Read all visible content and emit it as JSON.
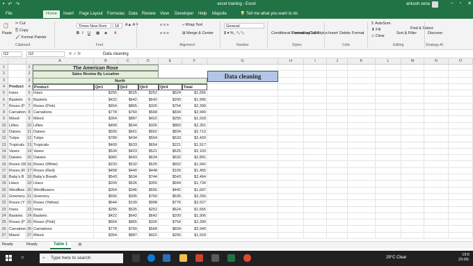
{
  "app": {
    "title": "excel training  -  Excel",
    "user": "ankush sena",
    "tabs": [
      "File",
      "Home",
      "Insert",
      "Page Layout",
      "Formulas",
      "Data",
      "Review",
      "View",
      "Developer",
      "Help",
      "Mapcite"
    ],
    "active_tab": "Home",
    "tell_me": "Tell me what you want to do",
    "accent": "#217346"
  },
  "ribbon": {
    "clipboard": {
      "paste": "Paste",
      "cut": "Cut",
      "copy": "Copy",
      "format_painter": "Format Painter",
      "label": "Clipboard"
    },
    "font": {
      "name": "Times New Rom",
      "size": "18",
      "label": "Font"
    },
    "alignment": {
      "wrap": "Wrap Text",
      "merge": "Merge & Center",
      "label": "Alignment"
    },
    "number": {
      "format": "General",
      "label": "Number"
    },
    "styles": {
      "cond": "Conditional Formatting",
      "table": "Format as Table",
      "cell": "Cell Styles",
      "label": "Styles"
    },
    "cells": {
      "insert": "Insert",
      "delete": "Delete",
      "format": "Format",
      "label": "Cells"
    },
    "editing": {
      "autosum": "AutoSum",
      "fill": "Fill",
      "clear": "Clear",
      "sort": "Sort & Filter",
      "find": "Find & Select",
      "label": "Editing"
    },
    "strategy": {
      "discover": "Discover",
      "label": "Strategy-AI"
    }
  },
  "formula_bar": {
    "name_box": "G2",
    "name_box2": "G2",
    "value": "Data cleaning"
  },
  "columns": [
    "A",
    "B",
    "C",
    "D",
    "E",
    "F",
    "G",
    "H",
    "I",
    "J",
    "K",
    "L",
    "M",
    "N",
    "O",
    "P"
  ],
  "row_numbers": [
    "1",
    "2",
    "3",
    "4",
    "5",
    "6",
    "7",
    "8",
    "9",
    "10",
    "11",
    "12",
    "13",
    "14",
    "15",
    "16",
    "17",
    "18",
    "19",
    "20",
    "21",
    "22",
    "23",
    "24",
    "25",
    "26",
    "27"
  ],
  "inner_row_numbers": [
    "1",
    "2",
    "3",
    "4",
    "5",
    "6",
    "7",
    "8",
    "9",
    "10",
    "11",
    "12",
    "13",
    "14",
    "15",
    "16",
    "17",
    "18",
    "19",
    "20",
    "21",
    "22",
    "23",
    "24",
    "25",
    "26",
    "27"
  ],
  "sheet": {
    "title": "The American Rose",
    "subtitle": "Sales Review By Location",
    "region": "North",
    "headers": [
      "Product",
      "Qtr1",
      "Qtr2",
      "Qtr3",
      "Qtr4",
      "Total"
    ],
    "outer_header": "Product",
    "g_cell": "Data cleaning",
    "rows": [
      [
        "Irises",
        "$255",
        "$525",
        "$252",
        "$624",
        "$1,656"
      ],
      [
        "Baskets",
        "$422",
        "$642",
        "$642",
        "$200",
        "$1,906"
      ],
      [
        "Roses (Pink)",
        "$654",
        "$865",
        "$326",
        "$754",
        "$2,399"
      ],
      [
        "Carnations",
        "$778",
        "$760",
        "$568",
        "$834",
        "$2,940"
      ],
      [
        "Mixed",
        "$354",
        "$887",
        "$422",
        "$255",
        "$1,918"
      ],
      [
        "Lillies",
        "$458",
        "$634",
        "$326",
        "$883",
        "$2,301"
      ],
      [
        "Daises",
        "$556",
        "$661",
        "$662",
        "$834",
        "$2,713"
      ],
      [
        "Tulips",
        "$789",
        "$434",
        "$564",
        "$633",
        "$2,420"
      ],
      [
        "Tropicals",
        "$409",
        "$633",
        "$654",
        "$221",
        "$1,917"
      ],
      [
        "Vases",
        "$534",
        "$423",
        "$521",
        "$625",
        "$2,103"
      ],
      [
        "Daisies",
        "$982",
        "$643",
        "$634",
        "$632",
        "$2,891"
      ],
      [
        "Roses (White)",
        "$233",
        "$532",
        "$525",
        "$652",
        "$1,942"
      ],
      [
        "Roses (Red)",
        "$458",
        "$440",
        "$448",
        "$109",
        "$1,455"
      ],
      [
        "Baby's Breath",
        "$543",
        "$634",
        "$744",
        "$543",
        "$2,464"
      ],
      [
        "Lilacs",
        "$209",
        "$526",
        "$355",
        "$644",
        "$1,734"
      ],
      [
        "Windflowers",
        "$354",
        "$346",
        "$555",
        "$442",
        "$1,697"
      ],
      [
        "Greenery",
        "$556",
        "$305",
        "$760",
        "$635",
        "$2,256"
      ],
      [
        "Roses (Yellow)",
        "$644",
        "$109",
        "$998",
        "$776",
        "$2,527"
      ],
      [
        "Irises",
        "$255",
        "$525",
        "$252",
        "$624",
        "$1,656"
      ],
      [
        "Baskets",
        "$422",
        "$642",
        "$642",
        "$200",
        "$1,906"
      ],
      [
        "Roses (Pink)",
        "$654",
        "$865",
        "$326",
        "$754",
        "$2,399"
      ],
      [
        "Carnations",
        "$778",
        "$760",
        "$568",
        "$834",
        "$2,940"
      ],
      [
        "Mixed",
        "$354",
        "$887",
        "$422",
        "$255",
        "$1,918"
      ]
    ],
    "outer_products": [
      "Irises",
      "Baskets",
      "Roses (P",
      "Carnation",
      "Mixed",
      "Lillies",
      "Daises",
      "Tulips",
      "Tropicals",
      "Vases",
      "Daisies",
      "Roses (W",
      "Roses (R",
      "Baby's B",
      "Lilacs",
      "Windflow",
      "Greenery",
      "Roses (Y",
      "Irises",
      "Baskets",
      "Roses (P",
      "Carnation",
      "Mixed"
    ]
  },
  "status": {
    "ready": "Ready",
    "ready2": "Ready",
    "sheet_tab": "Table 1"
  },
  "taskbar": {
    "search": "Type here to search",
    "weather": "29°C  Clear",
    "time": "19:5",
    "date": "23-09-"
  }
}
